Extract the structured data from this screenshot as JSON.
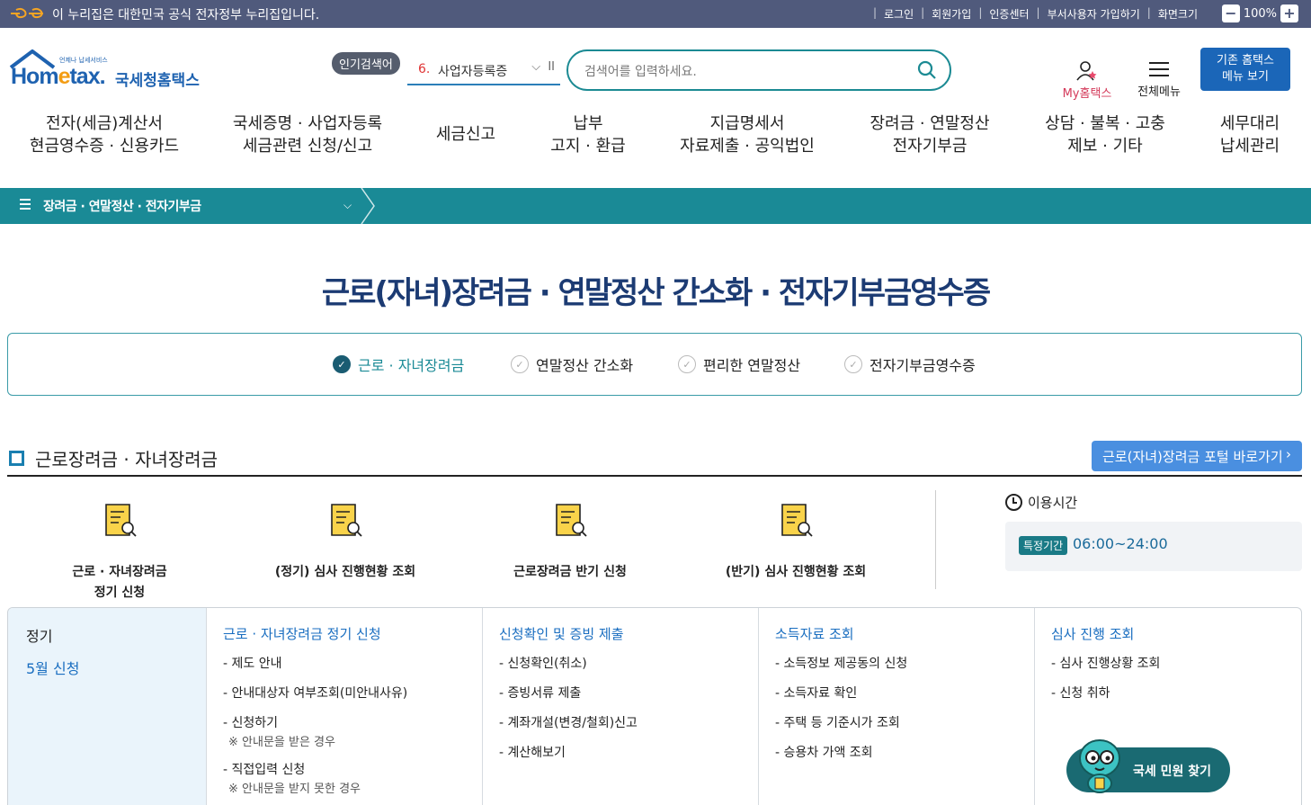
{
  "topbar": {
    "notice": "이 누리집은 대한민국 공식 전자정부 누리집입니다.",
    "links": [
      "로그인",
      "회원가입",
      "인증센터",
      "부서사용자 가입하기",
      "화면크기"
    ],
    "zoom": "100%"
  },
  "logo": {
    "sub": "언제나 납세서비스",
    "brand_a": "Hom",
    "brand_b": "e",
    "brand_c": "tax.",
    "kr": "국세청홈택스"
  },
  "popular": {
    "tag": "인기검색어",
    "rank": "6.",
    "text": "사업자등록증"
  },
  "search": {
    "placeholder": "검색어를 입력하세요."
  },
  "util": {
    "myhome": "My홈택스",
    "allmenu": "전체메뉴",
    "oldmenu": "기존 홈택스\n메뉴 보기"
  },
  "gnb": [
    "전자(세금)계산서\n현금영수증 · 신용카드",
    "국세증명 · 사업자등록\n세금관련 신청/신고",
    "세금신고",
    "납부\n고지 · 환급",
    "지급명세서\n자료제출 · 공익법인",
    "장려금 · 연말정산\n전자기부금",
    "상담 · 불복 · 고충\n제보 · 기타",
    "세무대리\n납세관리"
  ],
  "breadcrumb": {
    "label": "장려금 · 연말정산 · 전자기부금"
  },
  "page_title": "근로(자녀)장려금 · 연말정산 간소화 · 전자기부금영수증",
  "tabs": [
    "근로 · 자녀장려금",
    "연말정산 간소화",
    "편리한 연말정산",
    "전자기부금영수증"
  ],
  "section": {
    "title": "근로장려금 · 자녀장려금",
    "portal_button": "근로(자녀)장려금 포털 바로가기"
  },
  "services": [
    "근로 · 자녀장려금\n정기 신청",
    "(정기) 심사 진행현황 조회",
    "근로장려금 반기 신청",
    "(반기) 심사 진행현황 조회"
  ],
  "usetime": {
    "label": "이용시간",
    "badge": "특정기간",
    "time": "06:00~24:00"
  },
  "table": {
    "left_key": "정기",
    "left_value": "5월 신청",
    "columns": [
      {
        "head": "근로 · 자녀장려금 정기 신청",
        "items": [
          {
            "t": "- 제도 안내"
          },
          {
            "t": "- 안내대상자 여부조회(미안내사유)"
          },
          {
            "t": "- 신청하기",
            "n": "※ 안내문을 받은 경우"
          },
          {
            "t": "- 직접입력 신청",
            "n": "※ 안내문을 받지 못한 경우"
          }
        ]
      },
      {
        "head": "신청확인 및 증빙 제출",
        "items": [
          {
            "t": "- 신청확인(취소)"
          },
          {
            "t": "- 증빙서류 제출"
          },
          {
            "t": "- 계좌개설(변경/철회)신고"
          },
          {
            "t": "- 계산해보기"
          }
        ]
      },
      {
        "head": "소득자료 조회",
        "items": [
          {
            "t": "- 소득정보 제공동의 신청"
          },
          {
            "t": "- 소득자료 확인"
          },
          {
            "t": "- 주택 등 기준시가 조회"
          },
          {
            "t": "- 승용차 가액 조회"
          }
        ]
      },
      {
        "head": "심사 진행 조회",
        "items": [
          {
            "t": "- 심사 진행상황 조회"
          },
          {
            "t": "- 신청 취하"
          }
        ]
      }
    ]
  },
  "chatbot": {
    "label": "국세 민원 찾기"
  }
}
